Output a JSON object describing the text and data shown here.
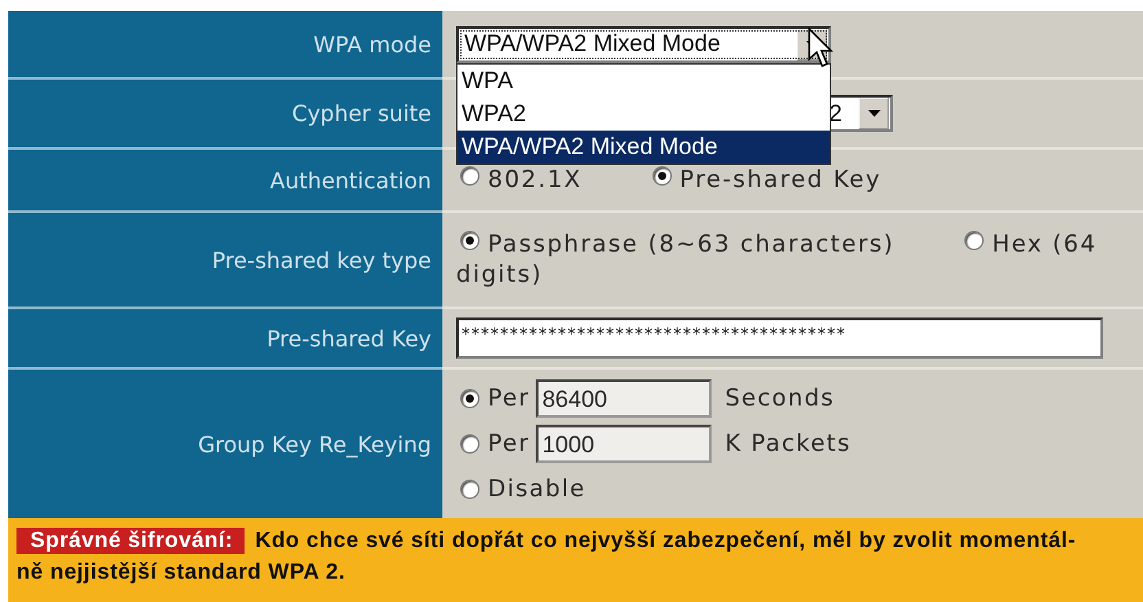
{
  "form": {
    "rows": [
      {
        "kind": "select",
        "label": "WPA mode",
        "value": "WPA/WPA2 Mixed Mode",
        "expanded": true,
        "options": [
          {
            "label": "WPA",
            "selected": false
          },
          {
            "label": "WPA2",
            "selected": false
          },
          {
            "label": "WPA/WPA2 Mixed Mode",
            "selected": true
          }
        ]
      },
      {
        "kind": "select",
        "label": "Cypher suite",
        "value": "2",
        "expanded": false
      },
      {
        "kind": "radios",
        "label": "Authentication",
        "options": [
          {
            "label": "802.1X",
            "selected": false
          },
          {
            "label": "Pre-shared Key",
            "selected": true
          }
        ]
      },
      {
        "kind": "radios",
        "label": "Pre-shared key type",
        "options": [
          {
            "label": "Passphrase (8~63 characters)",
            "selected": true
          },
          {
            "label_lines": [
              "Hex (64",
              "digits)"
            ],
            "selected": false
          }
        ]
      },
      {
        "kind": "password",
        "label": "Pre-shared Key",
        "value": "****************************************"
      },
      {
        "kind": "rekey",
        "label": "Group Key Re_Keying",
        "options": [
          {
            "label": "Per",
            "value": "86400",
            "unit": "Seconds",
            "selected": true
          },
          {
            "label": "Per",
            "value": "1000",
            "unit": "K Packets",
            "selected": false
          },
          {
            "label": "Disable",
            "selected": false
          }
        ]
      }
    ]
  },
  "caption": {
    "label": "Správné šifrování:",
    "text_lines": [
      "Kdo chce své síti dopřát co nejvyšší zabezpečení, měl by zvolit momentál-",
      "ně nejjistější standard WPA 2."
    ]
  }
}
